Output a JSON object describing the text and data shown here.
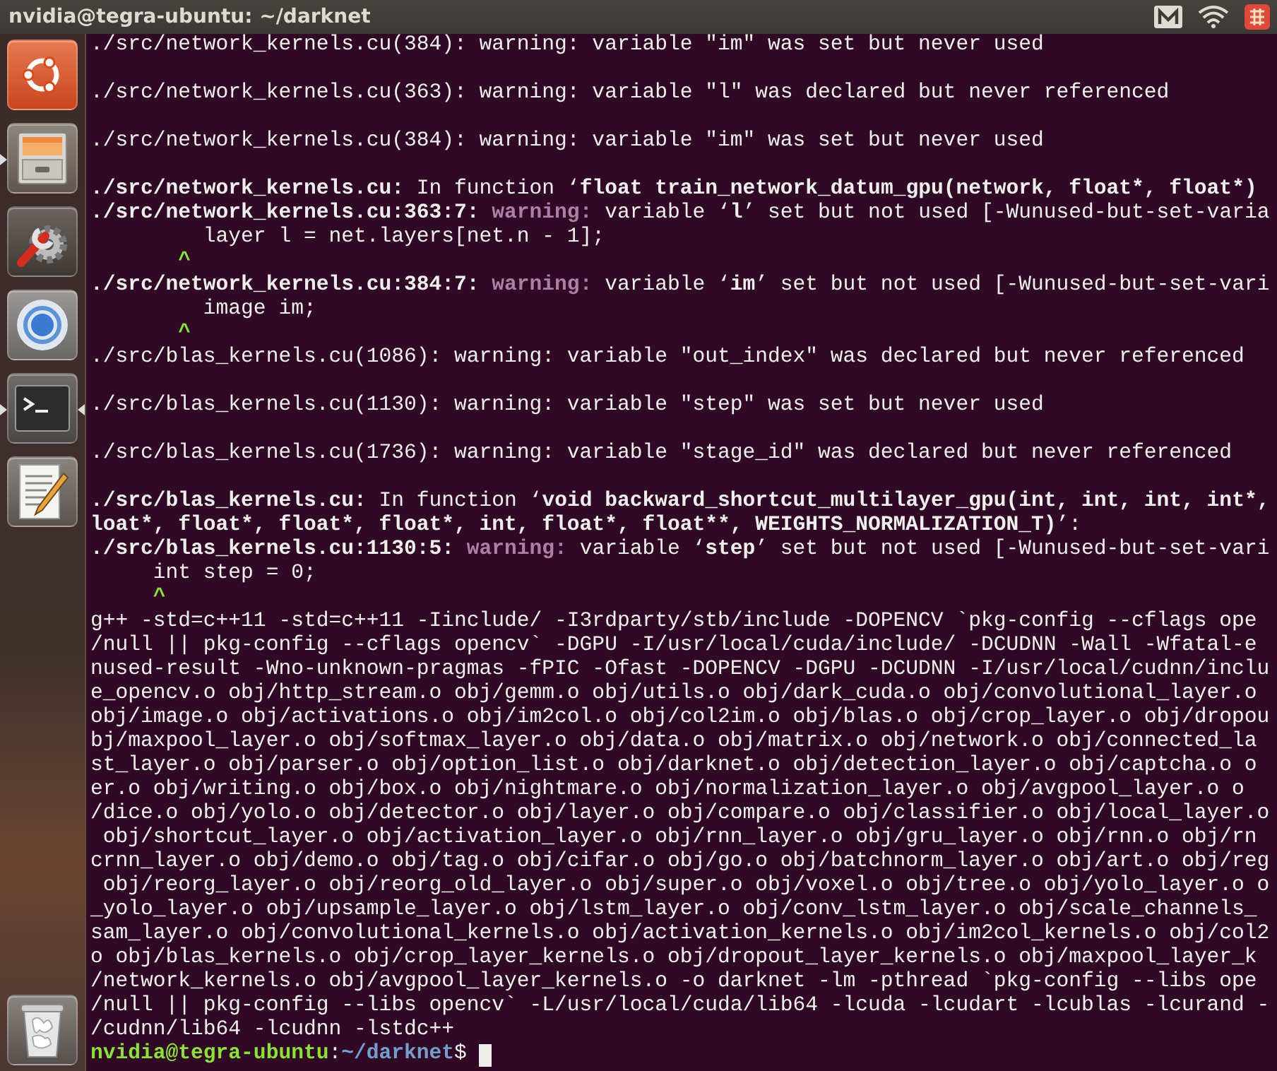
{
  "window": {
    "title": "nvidia@tegra-ubuntu: ~/darknet"
  },
  "launcher": {
    "items": [
      {
        "kind": "ubuntu",
        "running": false,
        "focused": false
      },
      {
        "kind": "files",
        "running": true,
        "focused": false
      },
      {
        "kind": "settings",
        "running": false,
        "focused": false
      },
      {
        "kind": "browser",
        "running": false,
        "focused": false
      },
      {
        "kind": "terminal",
        "running": true,
        "focused": true
      },
      {
        "kind": "editor",
        "running": false,
        "focused": false
      },
      {
        "kind": "trash",
        "running": false,
        "focused": false
      }
    ]
  },
  "terminal": {
    "lines": [
      {
        "kind": "text",
        "text": "./src/network_kernels.cu(384): warning: variable \"im\" was set but never used"
      },
      {
        "kind": "blank"
      },
      {
        "kind": "text",
        "text": "./src/network_kernels.cu(363): warning: variable \"l\" was declared but never referenced"
      },
      {
        "kind": "blank"
      },
      {
        "kind": "text",
        "text": "./src/network_kernels.cu(384): warning: variable \"im\" was set but never used"
      },
      {
        "kind": "blank"
      },
      {
        "kind": "text",
        "text": "**./src/network_kernels.cu:** In function ‘**float train_network_datum_gpu(network, float*, float*)**"
      },
      {
        "kind": "diagnostic",
        "location": "./src/network_kernels.cu:363:7:",
        "severity": "warning:",
        "message": "variable ‘**l**’ set but not used [-Wunused-but-set-varia"
      },
      {
        "kind": "text",
        "text": "         layer l = net.layers[net.n - 1];"
      },
      {
        "kind": "caret",
        "text": "       ^"
      },
      {
        "kind": "diagnostic",
        "location": "./src/network_kernels.cu:384:7:",
        "severity": "warning:",
        "message": "variable ‘**im**’ set but not used [-Wunused-but-set-vari"
      },
      {
        "kind": "text",
        "text": "         image im;"
      },
      {
        "kind": "caret",
        "text": "       ^"
      },
      {
        "kind": "text",
        "text": "./src/blas_kernels.cu(1086): warning: variable \"out_index\" was declared but never referenced"
      },
      {
        "kind": "blank"
      },
      {
        "kind": "text",
        "text": "./src/blas_kernels.cu(1130): warning: variable \"step\" was set but never used"
      },
      {
        "kind": "blank"
      },
      {
        "kind": "text",
        "text": "./src/blas_kernels.cu(1736): warning: variable \"stage_id\" was declared but never referenced"
      },
      {
        "kind": "blank"
      },
      {
        "kind": "text",
        "text": "**./src/blas_kernels.cu:** In function ‘**void backward_shortcut_multilayer_gpu(int, int, int, int*,**"
      },
      {
        "kind": "continuation",
        "code": "loat*, float*, float*, float*, int, float*, float**, WEIGHTS_NORMALIZATION_T)",
        "suffix": "’:"
      },
      {
        "kind": "diagnostic",
        "location": "./src/blas_kernels.cu:1130:5:",
        "severity": "warning:",
        "message": "variable ‘**step**’ set but not used [-Wunused-but-set-vari"
      },
      {
        "kind": "text",
        "text": "     int step = 0;"
      },
      {
        "kind": "caret",
        "text": "     ^"
      },
      {
        "kind": "text",
        "text": "g++ -std=c++11 -std=c++11 -Iinclude/ -I3rdparty/stb/include -DOPENCV `pkg-config --cflags ope"
      },
      {
        "kind": "text",
        "text": "/null || pkg-config --cflags opencv` -DGPU -I/usr/local/cuda/include/ -DCUDNN -Wall -Wfatal-e"
      },
      {
        "kind": "text",
        "text": "nused-result -Wno-unknown-pragmas -fPIC -Ofast -DOPENCV -DGPU -DCUDNN -I/usr/local/cudnn/inclu"
      },
      {
        "kind": "text",
        "text": "e_opencv.o obj/http_stream.o obj/gemm.o obj/utils.o obj/dark_cuda.o obj/convolutional_layer.o"
      },
      {
        "kind": "text",
        "text": "obj/image.o obj/activations.o obj/im2col.o obj/col2im.o obj/blas.o obj/crop_layer.o obj/dropou"
      },
      {
        "kind": "text",
        "text": "bj/maxpool_layer.o obj/softmax_layer.o obj/data.o obj/matrix.o obj/network.o obj/connected_la"
      },
      {
        "kind": "text",
        "text": "st_layer.o obj/parser.o obj/option_list.o obj/darknet.o obj/detection_layer.o obj/captcha.o o"
      },
      {
        "kind": "text",
        "text": "er.o obj/writing.o obj/box.o obj/nightmare.o obj/normalization_layer.o obj/avgpool_layer.o o"
      },
      {
        "kind": "text",
        "text": "/dice.o obj/yolo.o obj/detector.o obj/layer.o obj/compare.o obj/classifier.o obj/local_layer.o"
      },
      {
        "kind": "text",
        "text": " obj/shortcut_layer.o obj/activation_layer.o obj/rnn_layer.o obj/gru_layer.o obj/rnn.o obj/rn"
      },
      {
        "kind": "text",
        "text": "crnn_layer.o obj/demo.o obj/tag.o obj/cifar.o obj/go.o obj/batchnorm_layer.o obj/art.o obj/reg"
      },
      {
        "kind": "text",
        "text": " obj/reorg_layer.o obj/reorg_old_layer.o obj/super.o obj/voxel.o obj/tree.o obj/yolo_layer.o o"
      },
      {
        "kind": "text",
        "text": "_yolo_layer.o obj/upsample_layer.o obj/lstm_layer.o obj/conv_lstm_layer.o obj/scale_channels_"
      },
      {
        "kind": "text",
        "text": "sam_layer.o obj/convolutional_kernels.o obj/activation_kernels.o obj/im2col_kernels.o obj/col2"
      },
      {
        "kind": "text",
        "text": "o obj/blas_kernels.o obj/crop_layer_kernels.o obj/dropout_layer_kernels.o obj/maxpool_layer_k"
      },
      {
        "kind": "text",
        "text": "/network_kernels.o obj/avgpool_layer_kernels.o -o darknet -lm -pthread `pkg-config --libs ope"
      },
      {
        "kind": "text",
        "text": "/null || pkg-config --libs opencv` -L/usr/local/cuda/lib64 -lcuda -lcudart -lcublas -lcurand -"
      },
      {
        "kind": "text",
        "text": "/cudnn/lib64 -lcudnn -lstdc++"
      },
      {
        "kind": "prompt",
        "user": "nvidia@tegra-ubuntu",
        "separator": ":",
        "path": "~/darknet",
        "symbol": "$",
        "cursor": true
      }
    ]
  }
}
